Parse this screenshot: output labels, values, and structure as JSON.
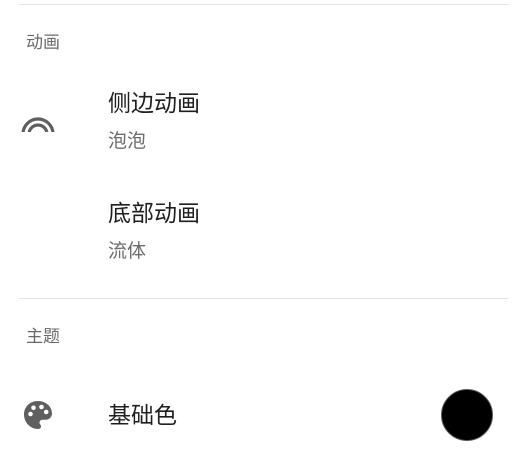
{
  "sections": {
    "animation": {
      "header": "动画",
      "items": [
        {
          "title": "侧边动画",
          "summary": "泡泡",
          "icon": "rainbow-arc-icon"
        },
        {
          "title": "底部动画",
          "summary": "流体"
        }
      ]
    },
    "theme": {
      "header": "主题",
      "items": [
        {
          "title": "基础色",
          "icon": "palette-icon",
          "swatch_color": "#000000"
        }
      ]
    }
  }
}
